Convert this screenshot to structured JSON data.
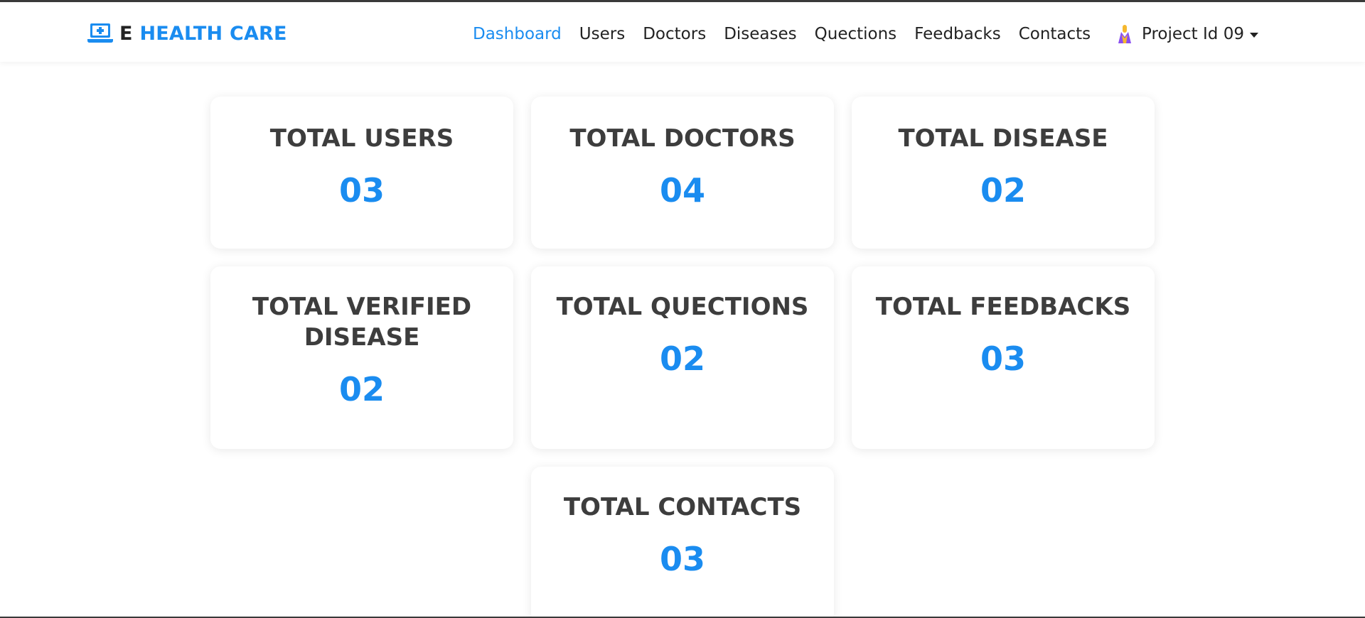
{
  "brand": {
    "prefix": "E",
    "name": "HEALTH CARE",
    "icon": "laptop-medical-icon",
    "color": "#1a8cf0"
  },
  "nav": {
    "items": [
      {
        "label": "Dashboard",
        "active": true
      },
      {
        "label": "Users",
        "active": false
      },
      {
        "label": "Doctors",
        "active": false
      },
      {
        "label": "Diseases",
        "active": false
      },
      {
        "label": "Quections",
        "active": false
      },
      {
        "label": "Feedbacks",
        "active": false
      },
      {
        "label": "Contacts",
        "active": false
      }
    ],
    "active_color": "#1a8cf0"
  },
  "user": {
    "name": "Project Id 09",
    "avatar_icon": "user-avatar-icon"
  },
  "stats": [
    {
      "title": "TOTAL USERS",
      "value": "03"
    },
    {
      "title": "TOTAL DOCTORS",
      "value": "04"
    },
    {
      "title": "TOTAL DISEASE",
      "value": "02"
    },
    {
      "title": "TOTAL VERIFIED DISEASE",
      "value": "02"
    },
    {
      "title": "TOTAL QUECTIONS",
      "value": "02"
    },
    {
      "title": "TOTAL FEEDBACKS",
      "value": "03"
    },
    {
      "title": "TOTAL CONTACTS",
      "value": "03"
    }
  ],
  "colors": {
    "accent": "#1a8cf0",
    "title_text": "#3d3d3d"
  }
}
